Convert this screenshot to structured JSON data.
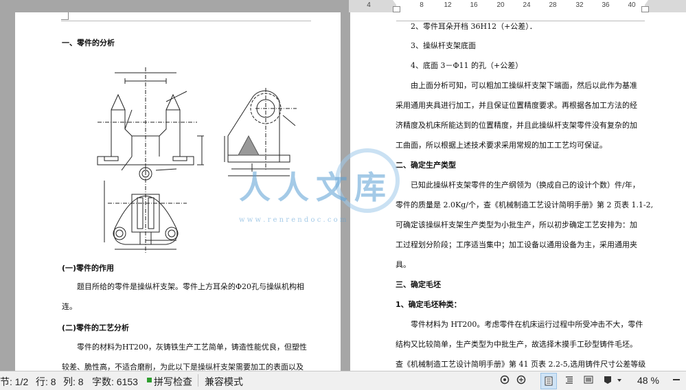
{
  "ruler": {
    "ticks": [
      "4",
      "4",
      "8",
      "12",
      "16",
      "20",
      "24",
      "28",
      "32",
      "36",
      "40"
    ]
  },
  "page_left": {
    "heading1": "一、零件的分析",
    "drawing_label": "engineering-drawing-of-bracket",
    "section1_title": "(一)零件的作用",
    "section1_line1": "题目所给的零件是操纵杆支架。零件上方耳朵的Φ20孔与操纵机构相",
    "section1_line2": "连。",
    "section2_title": "(二)零件的工艺分析",
    "section2_line1": "零件的材料为HT200，灰铸铁生产工艺简单，铸造性能优良，但塑性",
    "section2_line2": "较差、脆性高，不适合磨削，为此以下是操纵杆支架需要加工的表面以及"
  },
  "page_right": {
    "item2": "2、零件耳朵开档 36H12（+公差）．",
    "item3": "3、操纵杆支架底面",
    "item4": "4、底面 3－Φ11 的孔（+公差）",
    "para1_l1": "由上面分析可知，可以粗加工操纵杆支架下端面，然后以此作为基准",
    "para1_l2": "采用通用夹具进行加工，并且保证位置精度要求。再根据各加工方法的经",
    "para1_l3": "济精度及机床所能达到的位置精度，并且此操纵杆支架零件没有复杂的加",
    "para1_l4": "工曲面，所以根据上述技术要求采用常规的加工工艺均可保证。",
    "heading2": "二、确定生产类型",
    "para2_l1": "已知此操纵杆支架零件的生产纲领为（换成自己的设计个数）件/年，",
    "para2_l2": "零件的质量是 2.0Kg/个，查《机械制造工艺设计简明手册》第 2 页表 1.1-2,",
    "para2_l3": "可确定该操纵杆支架生产类型为小批生产，所以初步确定工艺安排为：加",
    "para2_l4": "工过程划分阶段；工序适当集中；加工设备以通用设备为主，采用通用夹",
    "para2_l5": "具。",
    "heading3": "三、确定毛坯",
    "heading3_1": "1、确定毛坯种类：",
    "para3_l1": "零件材料为 HT200。考虑零件在机床运行过程中所受冲击不大，零件",
    "para3_l2": "结构又比较简单，生产类型为中批生产，故选择木摸手工砂型铸件毛坯。",
    "para3_l3": "查《机械制造工艺设计简明手册》第 41 页表 2.2-5,选用铸件尺寸公差等级"
  },
  "watermark": {
    "text": "人人文库",
    "url": "w w w . r e n r e n d o c . c o m"
  },
  "status": {
    "page": "节: 1/2",
    "line": "行: 8",
    "col": "列: 8",
    "words": "字数: 6153",
    "spell": "拼写检查",
    "compat": "兼容模式",
    "zoom": "48 %"
  },
  "colors": {
    "background": "#a6a6a6",
    "watermark_blue": "#5a9fd4",
    "spell_green": "#2e9e2e"
  }
}
